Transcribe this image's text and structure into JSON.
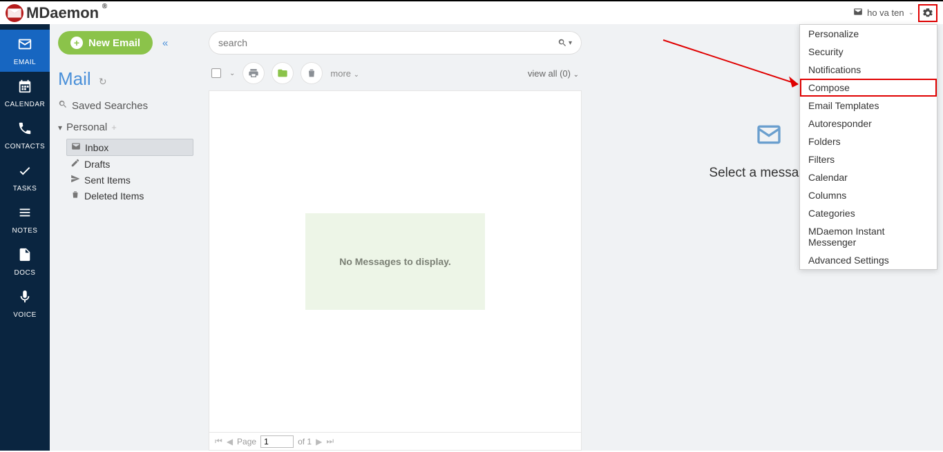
{
  "header": {
    "logo_text": "MDaemon",
    "user_name": "ho va ten"
  },
  "rail": {
    "items": [
      {
        "label": "EMAIL"
      },
      {
        "label": "CALENDAR"
      },
      {
        "label": "CONTACTS"
      },
      {
        "label": "TASKS"
      },
      {
        "label": "NOTES"
      },
      {
        "label": "DOCS"
      },
      {
        "label": "VOICE"
      }
    ]
  },
  "sidebar": {
    "new_email_label": "New Email",
    "mail_title": "Mail",
    "saved_searches": "Saved Searches",
    "personal_label": "Personal",
    "folders": [
      {
        "label": "Inbox"
      },
      {
        "label": "Drafts"
      },
      {
        "label": "Sent Items"
      },
      {
        "label": "Deleted Items"
      }
    ]
  },
  "list": {
    "search_placeholder": "search",
    "more_label": "more",
    "view_all_label": "view all (0)",
    "no_messages": "No Messages to display.",
    "pager_page_label": "Page",
    "pager_page_value": "1",
    "pager_of_label": "of 1"
  },
  "reading": {
    "hint": "Select a message to"
  },
  "settings_menu": {
    "items": [
      "Personalize",
      "Security",
      "Notifications",
      "Compose",
      "Email Templates",
      "Autoresponder",
      "Folders",
      "Filters",
      "Calendar",
      "Columns",
      "Categories",
      "MDaemon Instant Messenger",
      "Advanced Settings"
    ],
    "highlight_index": 3
  }
}
